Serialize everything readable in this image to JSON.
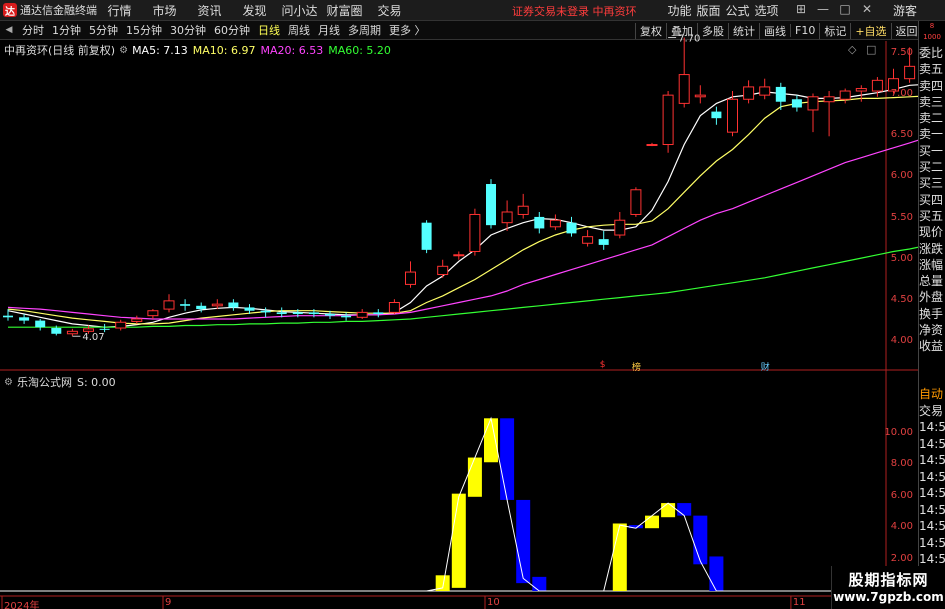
{
  "app": {
    "logo_glyph": "达",
    "title": "通达信金融终端",
    "notice": "证券交易未登录 中再资环"
  },
  "menu": [
    "行情",
    "市场",
    "资讯",
    "发现",
    "问小达",
    "财富圈",
    "交易"
  ],
  "menu_right": [
    "功能",
    "版面",
    "公式",
    "选项"
  ],
  "guest": "游客",
  "periods": [
    {
      "label": "分时",
      "active": false
    },
    {
      "label": "1分钟",
      "active": false
    },
    {
      "label": "5分钟",
      "active": false
    },
    {
      "label": "15分钟",
      "active": false
    },
    {
      "label": "30分钟",
      "active": false
    },
    {
      "label": "60分钟",
      "active": false
    },
    {
      "label": "日线",
      "active": true
    },
    {
      "label": "周线",
      "active": false
    },
    {
      "label": "月线",
      "active": false
    },
    {
      "label": "多周期",
      "active": false
    },
    {
      "label": "更多 〉",
      "active": false
    }
  ],
  "toolbar_right": [
    "复权",
    "叠加",
    "多股",
    "统计",
    "画线",
    "F10",
    "标记",
    "+自选",
    "返回"
  ],
  "side_top": "8\n1000",
  "side_items": [
    "委比",
    "卖五",
    "卖四",
    "卖三",
    "卖二",
    "卖一",
    "买一",
    "买二",
    "买三",
    "买四",
    "买五",
    "现价",
    "涨跌",
    "涨幅",
    "总量",
    "外盘",
    "换手",
    "净资",
    "收益"
  ],
  "side_lower": [
    "自动",
    "交易",
    "14:56",
    "14:56",
    "14:56",
    "14:56",
    "14:56",
    "14:56",
    "14:56",
    "14:56",
    "14:56",
    "14:56",
    "14:56"
  ],
  "chart_header": {
    "stock": "中再资环(日线 前复权)",
    "ma": [
      {
        "label": "MA5: 7.13",
        "color": "#ffffff"
      },
      {
        "label": "MA10: 6.97",
        "color": "#ffff66"
      },
      {
        "label": "MA20: 6.53",
        "color": "#ff44ff"
      },
      {
        "label": "MA60: 5.20",
        "color": "#33ff33"
      }
    ]
  },
  "indicator_header": {
    "name": "乐淘公式网",
    "value": "S: 0.00"
  },
  "colors": {
    "up": "#ff3232",
    "down": "#54ffff",
    "ind_yellow": "#ffff00",
    "ind_blue": "#0000ff",
    "axis": "#e04040"
  },
  "events": [
    {
      "label": "$",
      "color": "#ff3333"
    },
    {
      "label": "榜",
      "color": "#ffcc44"
    },
    {
      "label": "财",
      "color": "#66ccff"
    }
  ],
  "watermark": {
    "title": "股期指标网",
    "url": "www.7gpzb.com"
  },
  "chart_data": [
    {
      "type": "candlestick",
      "ylim": [
        3.85,
        7.95
      ],
      "yticks": [
        4.0,
        4.5,
        5.0,
        5.5,
        6.0,
        6.5,
        7.0,
        7.5
      ],
      "x_labels": [
        {
          "label": "2024年",
          "index": 0
        },
        {
          "label": "9",
          "index": 10
        },
        {
          "label": "10",
          "index": 30
        },
        {
          "label": "11",
          "index": 49
        }
      ],
      "annotations": [
        {
          "label": "7.70",
          "index": 41,
          "value": 7.7
        },
        {
          "label": "4.07",
          "index": 4,
          "value": 4.07
        }
      ],
      "candles": [
        {
          "o": 4.32,
          "c": 4.3,
          "h": 4.4,
          "l": 4.26
        },
        {
          "o": 4.3,
          "c": 4.26,
          "h": 4.34,
          "l": 4.22
        },
        {
          "o": 4.26,
          "c": 4.18,
          "h": 4.28,
          "l": 4.14
        },
        {
          "o": 4.17,
          "c": 4.1,
          "h": 4.2,
          "l": 4.08
        },
        {
          "o": 4.1,
          "c": 4.13,
          "h": 4.16,
          "l": 4.07
        },
        {
          "o": 4.13,
          "c": 4.16,
          "h": 4.2,
          "l": 4.1
        },
        {
          "o": 4.16,
          "c": 4.15,
          "h": 4.22,
          "l": 4.12
        },
        {
          "o": 4.17,
          "c": 4.24,
          "h": 4.27,
          "l": 4.14
        },
        {
          "o": 4.25,
          "c": 4.28,
          "h": 4.32,
          "l": 4.22
        },
        {
          "o": 4.32,
          "c": 4.38,
          "h": 4.4,
          "l": 4.28
        },
        {
          "o": 4.4,
          "c": 4.5,
          "h": 4.58,
          "l": 4.36
        },
        {
          "o": 4.46,
          "c": 4.44,
          "h": 4.52,
          "l": 4.38
        },
        {
          "o": 4.44,
          "c": 4.4,
          "h": 4.48,
          "l": 4.36
        },
        {
          "o": 4.44,
          "c": 4.46,
          "h": 4.52,
          "l": 4.4
        },
        {
          "o": 4.48,
          "c": 4.42,
          "h": 4.52,
          "l": 4.38
        },
        {
          "o": 4.42,
          "c": 4.38,
          "h": 4.46,
          "l": 4.34
        },
        {
          "o": 4.38,
          "c": 4.36,
          "h": 4.42,
          "l": 4.3
        },
        {
          "o": 4.36,
          "c": 4.34,
          "h": 4.42,
          "l": 4.3
        },
        {
          "o": 4.36,
          "c": 4.34,
          "h": 4.4,
          "l": 4.3
        },
        {
          "o": 4.36,
          "c": 4.34,
          "h": 4.4,
          "l": 4.3
        },
        {
          "o": 4.34,
          "c": 4.32,
          "h": 4.38,
          "l": 4.28
        },
        {
          "o": 4.32,
          "c": 4.3,
          "h": 4.36,
          "l": 4.26
        },
        {
          "o": 4.3,
          "c": 4.36,
          "h": 4.4,
          "l": 4.28
        },
        {
          "o": 4.36,
          "c": 4.34,
          "h": 4.4,
          "l": 4.3
        },
        {
          "o": 4.36,
          "c": 4.48,
          "h": 4.52,
          "l": 4.34
        },
        {
          "o": 4.7,
          "c": 4.85,
          "h": 4.98,
          "l": 4.66
        },
        {
          "o": 5.45,
          "c": 5.12,
          "h": 5.48,
          "l": 5.08
        },
        {
          "o": 4.82,
          "c": 4.92,
          "h": 5.0,
          "l": 4.78
        },
        {
          "o": 5.05,
          "c": 5.06,
          "h": 5.1,
          "l": 5.0
        },
        {
          "o": 5.1,
          "c": 5.55,
          "h": 5.62,
          "l": 5.05
        },
        {
          "o": 5.92,
          "c": 5.42,
          "h": 5.98,
          "l": 5.38
        },
        {
          "o": 5.45,
          "c": 5.58,
          "h": 5.72,
          "l": 5.35
        },
        {
          "o": 5.55,
          "c": 5.65,
          "h": 5.8,
          "l": 5.5
        },
        {
          "o": 5.52,
          "c": 5.38,
          "h": 5.58,
          "l": 5.32
        },
        {
          "o": 5.4,
          "c": 5.48,
          "h": 5.55,
          "l": 5.36
        },
        {
          "o": 5.45,
          "c": 5.32,
          "h": 5.52,
          "l": 5.28
        },
        {
          "o": 5.2,
          "c": 5.28,
          "h": 5.36,
          "l": 5.16
        },
        {
          "o": 5.25,
          "c": 5.18,
          "h": 5.35,
          "l": 5.12
        },
        {
          "o": 5.3,
          "c": 5.48,
          "h": 5.58,
          "l": 5.26
        },
        {
          "o": 5.55,
          "c": 5.85,
          "h": 5.88,
          "l": 5.52
        },
        {
          "o": 6.4,
          "c": 6.4,
          "h": 6.42,
          "l": 6.38
        },
        {
          "o": 6.4,
          "c": 7.0,
          "h": 7.05,
          "l": 6.3
        },
        {
          "o": 6.9,
          "c": 7.25,
          "h": 7.7,
          "l": 6.85
        },
        {
          "o": 6.98,
          "c": 7.0,
          "h": 7.12,
          "l": 6.9
        },
        {
          "o": 6.8,
          "c": 6.72,
          "h": 6.86,
          "l": 6.64
        },
        {
          "o": 6.55,
          "c": 6.95,
          "h": 7.05,
          "l": 6.5
        },
        {
          "o": 6.95,
          "c": 7.1,
          "h": 7.18,
          "l": 6.9
        },
        {
          "o": 7.0,
          "c": 7.1,
          "h": 7.2,
          "l": 6.95
        },
        {
          "o": 7.1,
          "c": 6.92,
          "h": 7.15,
          "l": 6.82
        },
        {
          "o": 6.95,
          "c": 6.85,
          "h": 7.0,
          "l": 6.8
        },
        {
          "o": 6.82,
          "c": 6.98,
          "h": 7.02,
          "l": 6.55
        },
        {
          "o": 6.92,
          "c": 6.98,
          "h": 7.05,
          "l": 6.5
        },
        {
          "o": 6.95,
          "c": 7.05,
          "h": 7.08,
          "l": 6.9
        },
        {
          "o": 7.05,
          "c": 7.08,
          "h": 7.12,
          "l": 6.92
        },
        {
          "o": 7.05,
          "c": 7.18,
          "h": 7.22,
          "l": 6.98
        },
        {
          "o": 7.05,
          "c": 7.2,
          "h": 7.32,
          "l": 7.02
        },
        {
          "o": 7.2,
          "c": 7.35,
          "h": 7.58,
          "l": 7.15
        },
        {
          "o": 7.15,
          "c": 7.32,
          "h": 7.38,
          "l": 7.1
        },
        {
          "o": 7.35,
          "c": 7.15,
          "h": 7.48,
          "l": 7.12
        }
      ],
      "series": [
        {
          "name": "MA5",
          "color": "#ffffff",
          "values": [
            4.38,
            4.34,
            4.3,
            4.26,
            4.22,
            4.2,
            4.18,
            4.19,
            4.21,
            4.24,
            4.3,
            4.35,
            4.39,
            4.41,
            4.42,
            4.41,
            4.39,
            4.37,
            4.36,
            4.35,
            4.34,
            4.33,
            4.33,
            4.33,
            4.36,
            4.48,
            4.68,
            4.8,
            4.98,
            5.12,
            5.3,
            5.38,
            5.45,
            5.5,
            5.49,
            5.45,
            5.4,
            5.36,
            5.36,
            5.4,
            5.6,
            5.95,
            6.4,
            6.75,
            6.9,
            6.98,
            7.0,
            7.04,
            7.02,
            7.0,
            6.96,
            6.96,
            6.97,
            7.0,
            7.03,
            7.07,
            7.12,
            7.13,
            7.13
          ]
        },
        {
          "name": "MA10",
          "color": "#ffff66",
          "values": [
            4.4,
            4.38,
            4.35,
            4.32,
            4.29,
            4.27,
            4.25,
            4.23,
            4.22,
            4.22,
            4.23,
            4.26,
            4.29,
            4.31,
            4.33,
            4.35,
            4.37,
            4.38,
            4.38,
            4.38,
            4.37,
            4.36,
            4.35,
            4.35,
            4.35,
            4.38,
            4.48,
            4.56,
            4.66,
            4.76,
            4.88,
            5.0,
            5.12,
            5.22,
            5.3,
            5.36,
            5.4,
            5.42,
            5.43,
            5.43,
            5.47,
            5.62,
            5.82,
            6.02,
            6.2,
            6.34,
            6.52,
            6.72,
            6.86,
            6.9,
            6.92,
            6.93,
            6.94,
            6.96,
            6.96,
            6.97,
            6.98,
            6.99,
            6.97
          ]
        },
        {
          "name": "MA20",
          "color": "#ff44ff",
          "values": [
            4.42,
            4.41,
            4.4,
            4.38,
            4.36,
            4.34,
            4.32,
            4.3,
            4.29,
            4.28,
            4.28,
            4.28,
            4.28,
            4.28,
            4.28,
            4.29,
            4.3,
            4.31,
            4.32,
            4.32,
            4.32,
            4.32,
            4.33,
            4.33,
            4.34,
            4.36,
            4.4,
            4.44,
            4.48,
            4.52,
            4.56,
            4.62,
            4.7,
            4.76,
            4.82,
            4.88,
            4.94,
            5.0,
            5.06,
            5.12,
            5.18,
            5.28,
            5.38,
            5.48,
            5.56,
            5.62,
            5.7,
            5.78,
            5.86,
            5.94,
            6.02,
            6.1,
            6.18,
            6.24,
            6.3,
            6.36,
            6.42,
            6.48,
            6.53
          ]
        },
        {
          "name": "MA60",
          "color": "#33ff33",
          "values": [
            4.18,
            4.18,
            4.18,
            4.18,
            4.18,
            4.18,
            4.18,
            4.18,
            4.18,
            4.19,
            4.19,
            4.2,
            4.2,
            4.21,
            4.21,
            4.22,
            4.22,
            4.23,
            4.23,
            4.24,
            4.24,
            4.25,
            4.25,
            4.26,
            4.27,
            4.28,
            4.3,
            4.32,
            4.34,
            4.36,
            4.38,
            4.4,
            4.42,
            4.44,
            4.46,
            4.48,
            4.5,
            4.52,
            4.54,
            4.56,
            4.58,
            4.6,
            4.63,
            4.66,
            4.69,
            4.72,
            4.75,
            4.78,
            4.82,
            4.86,
            4.9,
            4.94,
            4.98,
            5.02,
            5.06,
            5.1,
            5.13,
            5.17,
            5.2
          ]
        }
      ]
    },
    {
      "type": "bar",
      "title": "乐淘公式网",
      "ylim": [
        0,
        11.5
      ],
      "yticks": [
        2.0,
        4.0,
        6.0,
        8.0,
        10.0
      ],
      "bars": [
        {
          "index": 27,
          "low": 0.0,
          "high": 1.0,
          "color": "yellow"
        },
        {
          "index": 28,
          "low": 0.2,
          "high": 6.2,
          "color": "yellow"
        },
        {
          "index": 29,
          "low": 6.0,
          "high": 8.5,
          "color": "yellow"
        },
        {
          "index": 30,
          "low": 8.2,
          "high": 11.0,
          "color": "yellow"
        },
        {
          "index": 31,
          "low": 5.8,
          "high": 11.0,
          "color": "blue"
        },
        {
          "index": 32,
          "low": 0.5,
          "high": 5.8,
          "color": "blue"
        },
        {
          "index": 33,
          "low": 0.0,
          "high": 0.9,
          "color": "blue"
        },
        {
          "index": 38,
          "low": 0.0,
          "high": 4.3,
          "color": "yellow"
        },
        {
          "index": 39,
          "low": 4.0,
          "high": 4.2,
          "color": "blue"
        },
        {
          "index": 40,
          "low": 4.0,
          "high": 4.8,
          "color": "yellow"
        },
        {
          "index": 41,
          "low": 4.7,
          "high": 5.6,
          "color": "yellow"
        },
        {
          "index": 42,
          "low": 4.8,
          "high": 5.6,
          "color": "blue"
        },
        {
          "index": 43,
          "low": 1.7,
          "high": 4.8,
          "color": "blue"
        },
        {
          "index": 44,
          "low": 0.0,
          "high": 2.2,
          "color": "blue"
        }
      ],
      "series": [
        {
          "color": "#ffffff",
          "values": [
            0,
            0,
            0,
            0,
            0,
            0,
            0,
            0,
            0,
            0,
            0,
            0,
            0,
            0,
            0,
            0,
            0,
            0,
            0,
            0,
            0,
            0,
            0,
            0,
            0,
            0,
            0,
            0.2,
            6.0,
            8.5,
            11.0,
            5.8,
            0.8,
            0,
            0,
            0,
            0,
            0,
            4.2,
            4.0,
            4.8,
            5.6,
            4.8,
            1.9,
            0,
            0,
            0,
            0,
            0,
            0,
            0,
            0,
            0,
            0,
            0,
            0,
            0,
            0,
            0
          ]
        }
      ]
    }
  ]
}
